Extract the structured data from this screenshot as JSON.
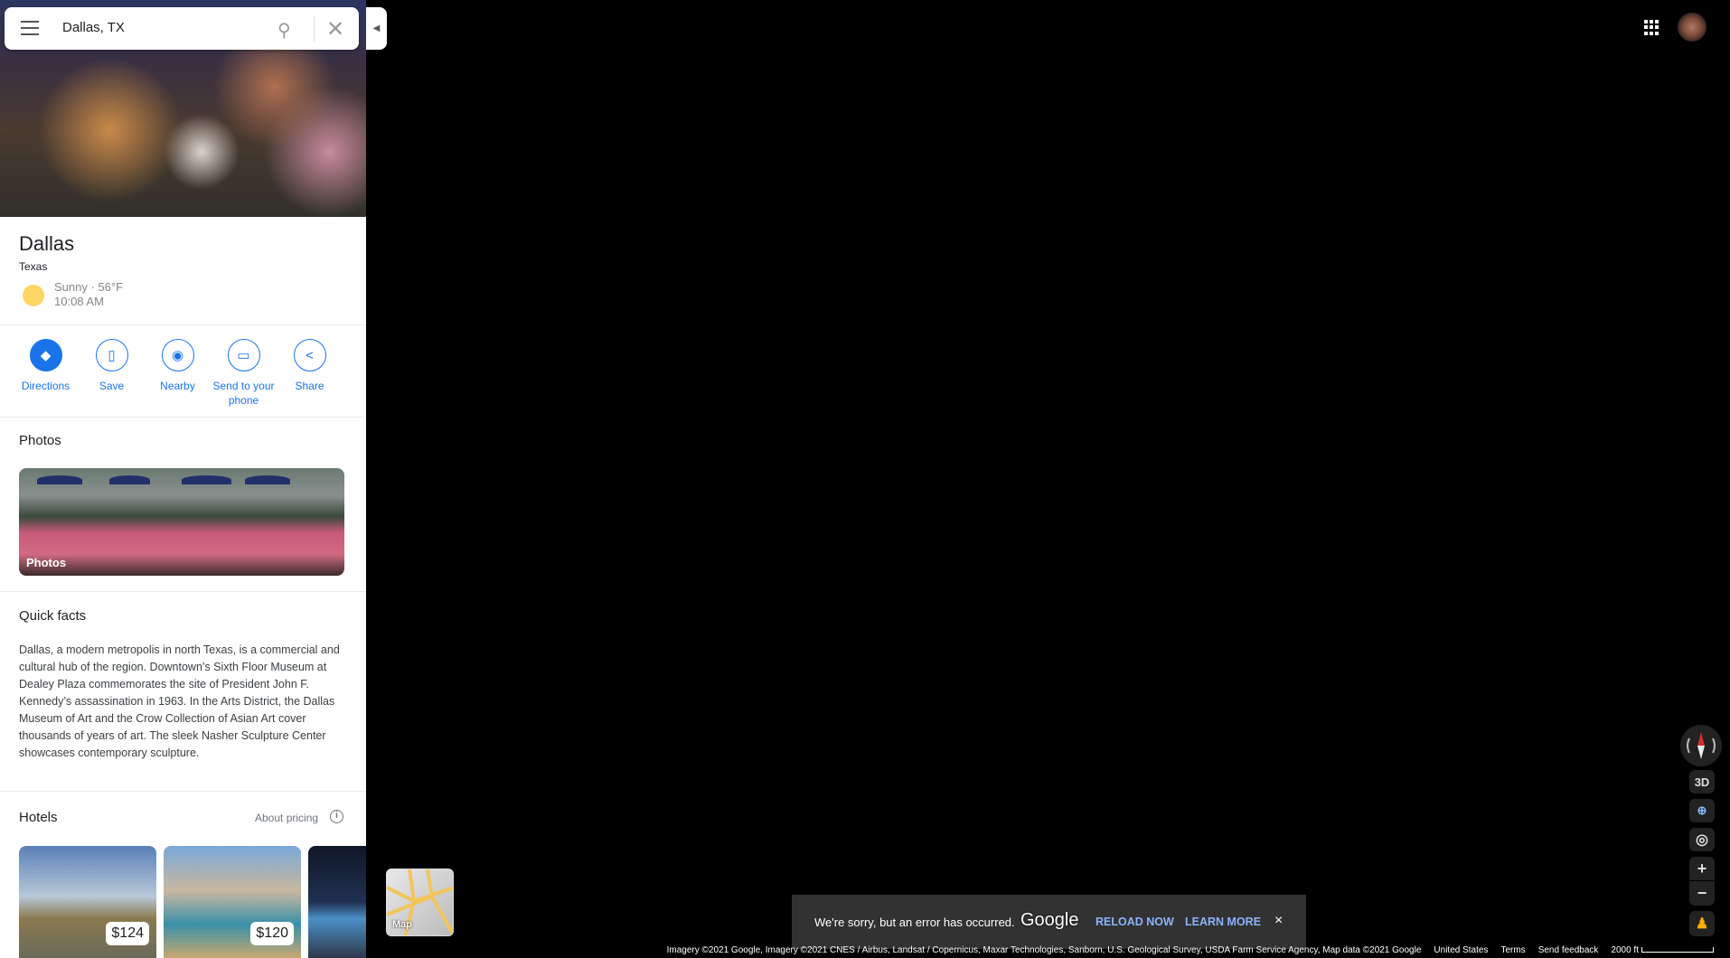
{
  "search": {
    "query": "Dallas, TX"
  },
  "place": {
    "name": "Dallas",
    "region": "Texas",
    "weather": "Sunny · 56°F",
    "time": "10:08 AM"
  },
  "actions": [
    {
      "label": "Directions",
      "icon": "directions-icon"
    },
    {
      "label": "Save",
      "icon": "bookmark-icon"
    },
    {
      "label": "Nearby",
      "icon": "nearby-icon"
    },
    {
      "label": "Send to your phone",
      "icon": "send-to-phone-icon"
    },
    {
      "label": "Share",
      "icon": "share-icon"
    }
  ],
  "photos": {
    "heading": "Photos",
    "card_label": "Photos"
  },
  "quick_facts": {
    "heading": "Quick facts",
    "text": "Dallas, a modern metropolis in north Texas, is a commercial and cultural hub of the region. Downtown’s Sixth Floor Museum at Dealey Plaza commemorates the site of President John F. Kennedy’s assassination in 1963. In the Arts District, the Dallas Museum of Art and the Crow Collection of Asian Art cover thousands of years of art. The sleek Nasher Sculpture Center showcases contemporary sculpture."
  },
  "hotels": {
    "heading": "Hotels",
    "about_pricing": "About pricing",
    "items": [
      {
        "price": "$124"
      },
      {
        "price": "$120"
      },
      {
        "price": ""
      }
    ]
  },
  "map_toggle": {
    "label": "Map"
  },
  "toast": {
    "message": "We're sorry, but an error has occurred.",
    "logo": "Google",
    "reload": "RELOAD NOW",
    "learn": "LEARN MORE",
    "close": "×"
  },
  "footer": {
    "attribution": "Imagery ©2021 Google, Imagery ©2021 CNES / Airbus, Landsat / Copernicus, Maxar Technologies, Sanborn, U.S. Geological Survey, USDA Farm Service Agency, Map data ©2021 Google",
    "country": "United States",
    "terms": "Terms",
    "feedback": "Send feedback",
    "scale": "2000 ft"
  },
  "controls": {
    "tilt": "3D",
    "zoom_in": "+",
    "zoom_out": "−"
  },
  "colors": {
    "accent": "#1a73e8",
    "toast_link": "#8ab4f8",
    "sun": "#fdd663"
  }
}
